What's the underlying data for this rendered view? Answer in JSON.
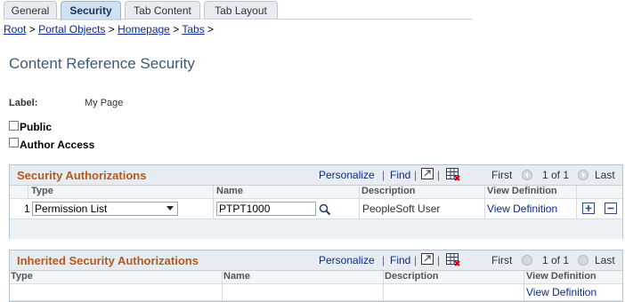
{
  "tabs": [
    {
      "label": "General",
      "active": false
    },
    {
      "label": "Security",
      "active": true
    },
    {
      "label": "Tab Content",
      "active": false
    },
    {
      "label": "Tab Layout",
      "active": false
    }
  ],
  "breadcrumb": {
    "items": [
      "Root",
      "Portal Objects",
      "Homepage",
      "Tabs"
    ],
    "sep": ">"
  },
  "page_title": "Content Reference Security",
  "label_field": {
    "label": "Label:",
    "value": "My Page"
  },
  "checkboxes": {
    "public": {
      "label": "Public",
      "checked": false
    },
    "author": {
      "label": "Author Access",
      "checked": false
    }
  },
  "grid1": {
    "title": "Security Authorizations",
    "personalize": "Personalize",
    "find": "Find",
    "first": "First",
    "range": "1 of 1",
    "last": "Last",
    "columns": {
      "type": "Type",
      "name": "Name",
      "description": "Description",
      "view": "View Definition"
    },
    "row": {
      "num": "1",
      "type": "Permission List",
      "name": "PTPT1000",
      "description": "PeopleSoft User",
      "view": "View Definition"
    }
  },
  "grid2": {
    "title": "Inherited Security Authorizations",
    "personalize": "Personalize",
    "find": "Find",
    "first": "First",
    "range": "1 of 1",
    "last": "Last",
    "columns": {
      "type": "Type",
      "name": "Name",
      "description": "Description",
      "view": "View Definition"
    },
    "row": {
      "view": "View Definition"
    }
  },
  "icons": [
    "view-all-icon",
    "download-spreadsheet-icon",
    "lookup-icon",
    "add-row-icon",
    "delete-row-icon",
    "previous-icon",
    "next-icon"
  ],
  "colors": {
    "title": "#3e5a78",
    "grid_title": "#b25a1f",
    "link": "#0d2a8c",
    "grid_header_bg": "#e6ecf2"
  }
}
